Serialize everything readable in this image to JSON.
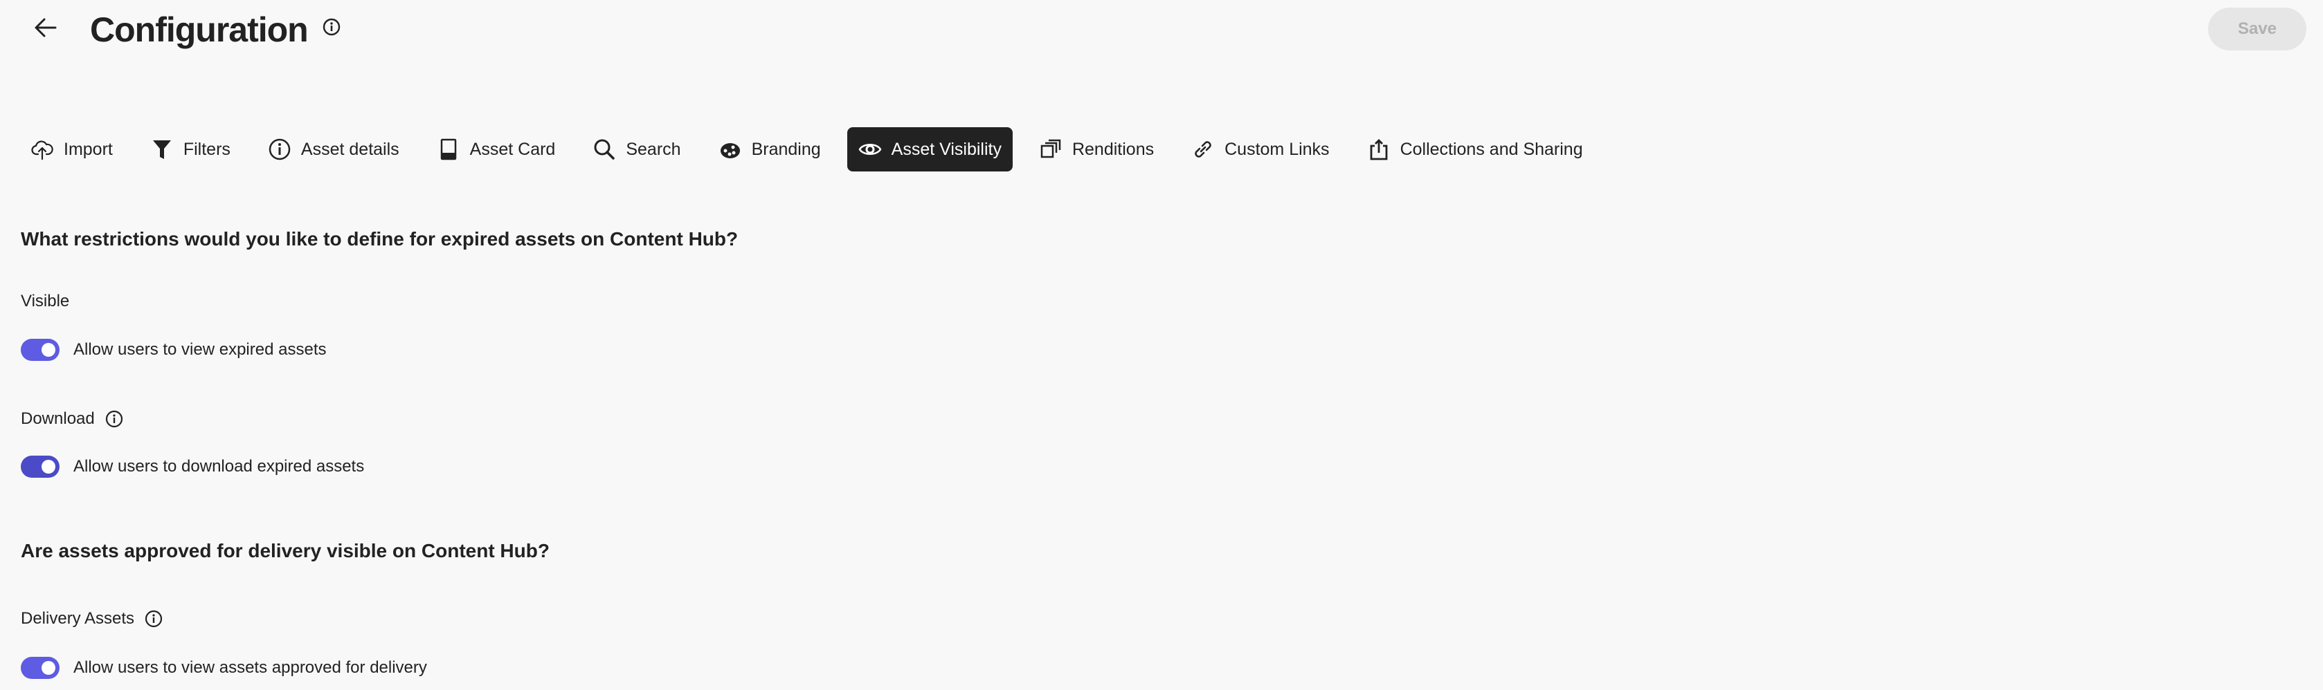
{
  "header": {
    "title": "Configuration",
    "save_label": "Save"
  },
  "tabs": [
    {
      "label": "Import",
      "icon": "upload-cloud-icon"
    },
    {
      "label": "Filters",
      "icon": "filter-icon"
    },
    {
      "label": "Asset details",
      "icon": "info-icon"
    },
    {
      "label": "Asset Card",
      "icon": "card-icon"
    },
    {
      "label": "Search",
      "icon": "search-icon"
    },
    {
      "label": "Branding",
      "icon": "palette-icon"
    },
    {
      "label": "Asset Visibility",
      "icon": "eye-icon",
      "active": true
    },
    {
      "label": "Renditions",
      "icon": "renditions-icon"
    },
    {
      "label": "Custom Links",
      "icon": "link-icon"
    },
    {
      "label": "Collections and Sharing",
      "icon": "share-icon"
    }
  ],
  "sections": {
    "expired": {
      "heading": "What restrictions would you like to define for expired assets on Content Hub?",
      "visible": {
        "label": "Visible",
        "toggle_label": "Allow users to view expired assets",
        "on": true
      },
      "download": {
        "label": "Download",
        "toggle_label": "Allow users to download expired assets",
        "on": true
      }
    },
    "delivery": {
      "heading": "Are assets approved for delivery visible on Content Hub?",
      "assets": {
        "label": "Delivery Assets",
        "toggle_label": "Allow users to view assets approved for delivery",
        "on": true
      }
    }
  },
  "colors": {
    "toggle_on": "#5d5ce2",
    "active_tab": "#222222"
  }
}
